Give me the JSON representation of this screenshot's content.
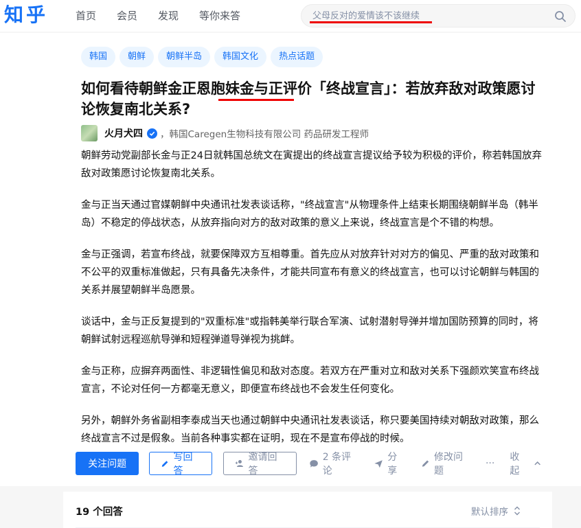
{
  "header": {
    "logo": "知乎",
    "nav": [
      "首页",
      "会员",
      "发现",
      "等你来答"
    ],
    "search_placeholder": "父母反对的爱情该不该继续"
  },
  "question": {
    "topics": [
      "韩国",
      "朝鲜",
      "朝鲜半岛",
      "韩国文化",
      "热点话题"
    ],
    "title": "如何看待朝鲜金正恩胞妹金与正评价「终战宣言」：若放弃敌对政策愿讨论恢复南北关系?",
    "author": {
      "name": "火月犬四",
      "bio": "，韩国Caregen生物科技有限公司 药品研发工程师"
    },
    "paragraphs": [
      "朝鲜劳动党副部长金与正24日就韩国总统文在寅提出的终战宣言提议给予较为积极的评价，称若韩国放弃敌对政策愿讨论恢复南北关系。",
      "金与正当天通过官媒朝鲜中央通讯社发表谈话称，\"终战宣言\"从物理条件上结束长期围绕朝鲜半岛（韩半岛）不稳定的停战状态，从放弃指向对方的敌对政策的意义上来说，终战宣言是个不错的构想。",
      "金与正强调，若宣布终战，就要保障双方互相尊重。首先应从对放弃针对对方的偏见、严重的敌对政策和不公平的双重标准做起，只有具备先决条件，才能共同宣布有意义的终战宣言，也可以讨论朝鲜与韩国的关系并展望朝鲜半岛愿景。",
      "谈话中，金与正反复提到的\"双重标准\"或指韩美举行联合军演、试射潜射导弹并增加国防预算的同时，将朝鲜试射远程巡航导弹和短程弹道导弹视为挑衅。",
      "金与正称，应摒弃两面性、非逻辑性偏见和敌对态度。若双方在严重对立和敌对关系下强颜欢笑宣布终战宣言，不论对任何一方都毫无意义，即便宣布终战也不会发生任何变化。",
      "另外，朝鲜外务省副相李泰成当天也通过朝鲜中央通讯社发表谈话，称只要美国持续对朝敌对政策，那么终战宣言不过是假象。当前各种事实都在证明，现在不是宣布停战的时候。"
    ],
    "actions": {
      "follow": "关注问题",
      "write": "写回答",
      "invite": "邀请回答",
      "comments": "2 条评论",
      "share": "分享",
      "edit": "修改问题",
      "more": "···",
      "collapse": "收起"
    }
  },
  "answers": {
    "count": "19 个回答",
    "sort": "默认排序"
  },
  "colors": {
    "brand": "#1772f6",
    "annotation": "#e00000"
  }
}
